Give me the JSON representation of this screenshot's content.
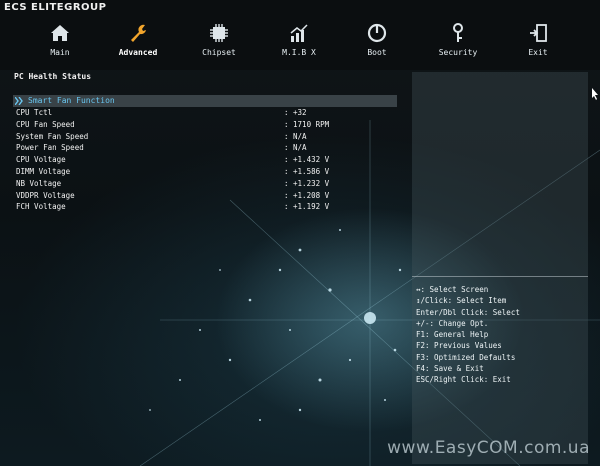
{
  "brand": {
    "logo_text": "ECS ELITEGROUP"
  },
  "nav": {
    "items": [
      {
        "label": "Main",
        "icon": "home-icon"
      },
      {
        "label": "Advanced",
        "icon": "wrench-icon"
      },
      {
        "label": "Chipset",
        "icon": "chip-icon"
      },
      {
        "label": "M.I.B X",
        "icon": "chart-icon"
      },
      {
        "label": "Boot",
        "icon": "power-icon"
      },
      {
        "label": "Security",
        "icon": "key-icon"
      },
      {
        "label": "Exit",
        "icon": "exit-icon"
      }
    ],
    "active": "Advanced"
  },
  "page": {
    "title": "PC Health Status"
  },
  "smart_fan": {
    "label": "Smart Fan Function"
  },
  "readings": [
    {
      "label": "CPU Tctl",
      "value": ": +32"
    },
    {
      "label": "CPU Fan Speed",
      "value": ": 1710 RPM"
    },
    {
      "label": "System Fan Speed",
      "value": ": N/A"
    },
    {
      "label": "Power Fan Speed",
      "value": ": N/A"
    },
    {
      "label": "CPU Voltage",
      "value": ": +1.432 V"
    },
    {
      "label": "DIMM Voltage",
      "value": ": +1.586 V"
    },
    {
      "label": "NB Voltage",
      "value": ": +1.232 V"
    },
    {
      "label": "VDDPR Voltage",
      "value": ": +1.208 V"
    },
    {
      "label": "FCH Voltage",
      "value": ": +1.192 V"
    }
  ],
  "help": [
    "↔: Select Screen",
    "↕/Click: Select Item",
    "Enter/Dbl Click: Select",
    "+/-: Change Opt.",
    "F1: General Help",
    "F2: Previous Values",
    "F3: Optimized Defaults",
    "F4: Save & Exit",
    "ESC/Right Click: Exit"
  ],
  "watermark": "www.EasyCOM.com.ua",
  "colors": {
    "accent": "#69c6f0",
    "highlight": "#6e7d82"
  }
}
